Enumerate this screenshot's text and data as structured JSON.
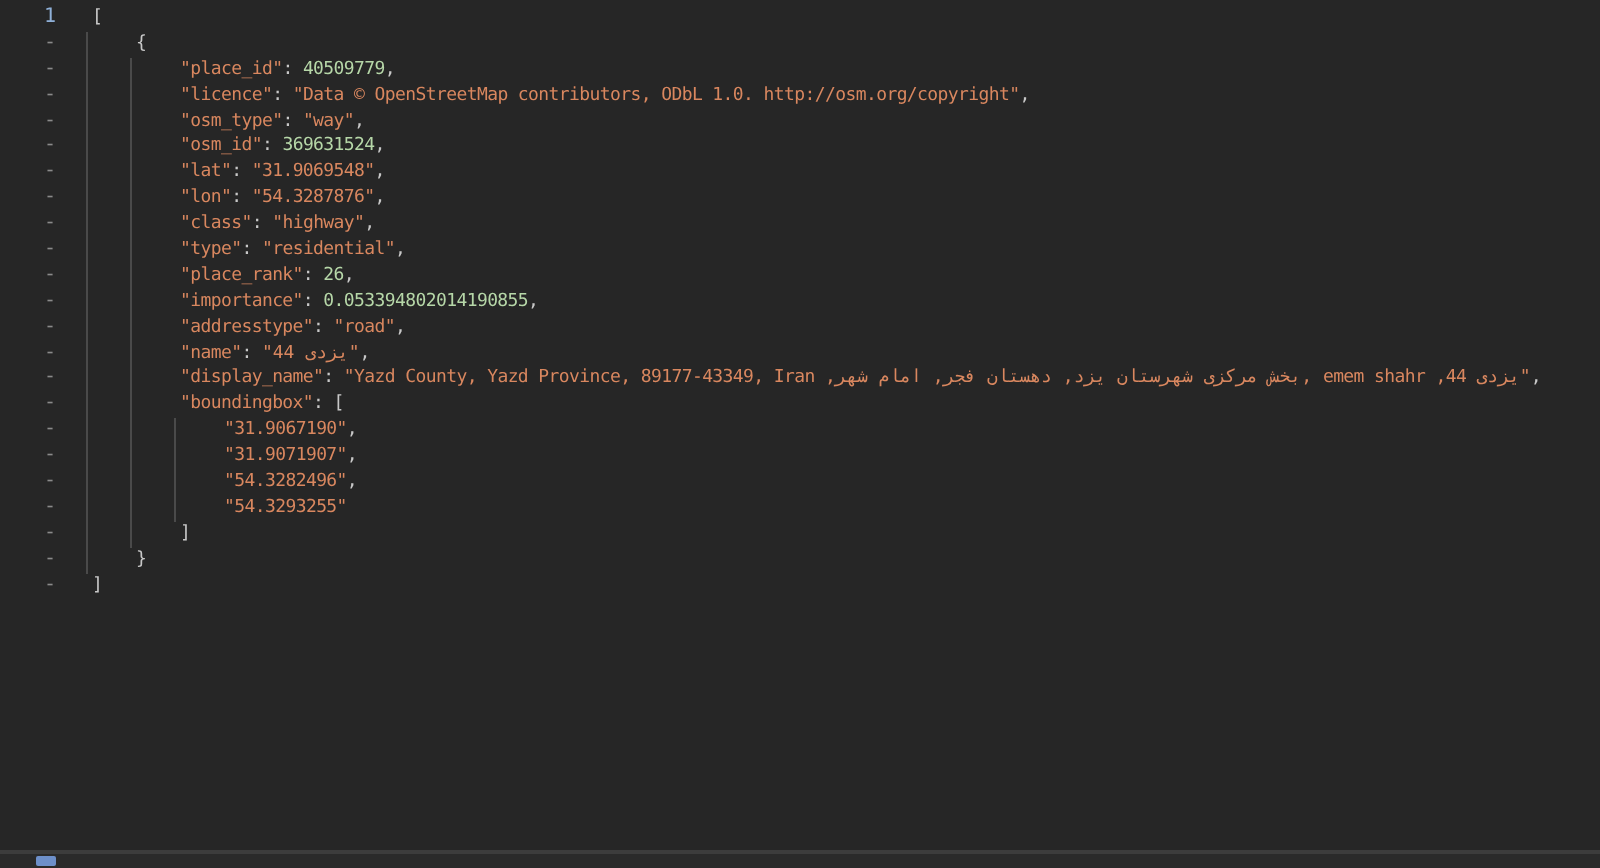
{
  "editor": {
    "lines": [
      {
        "gutter": "1",
        "tokens": [
          {
            "kind": "punct",
            "text": "["
          }
        ],
        "children": [
          {
            "gutter": "-",
            "tokens": [
              {
                "kind": "punct",
                "text": "{"
              }
            ],
            "children": [
              {
                "gutter": "-",
                "tokens": [
                  {
                    "kind": "key",
                    "text": "\"place_id\""
                  },
                  {
                    "kind": "punct",
                    "text": ": "
                  },
                  {
                    "kind": "number",
                    "text": "40509779"
                  },
                  {
                    "kind": "punct",
                    "text": ","
                  }
                ]
              },
              {
                "gutter": "-",
                "tokens": [
                  {
                    "kind": "key",
                    "text": "\"licence\""
                  },
                  {
                    "kind": "punct",
                    "text": ": "
                  },
                  {
                    "kind": "string",
                    "text": "\"Data © OpenStreetMap contributors, ODbL 1.0. http://osm.org/copyright\""
                  },
                  {
                    "kind": "punct",
                    "text": ","
                  }
                ]
              },
              {
                "gutter": "-",
                "tokens": [
                  {
                    "kind": "key",
                    "text": "\"osm_type\""
                  },
                  {
                    "kind": "punct",
                    "text": ": "
                  },
                  {
                    "kind": "string",
                    "text": "\"way\""
                  },
                  {
                    "kind": "punct",
                    "text": ","
                  }
                ]
              },
              {
                "gutter": "-",
                "tokens": [
                  {
                    "kind": "key",
                    "text": "\"osm_id\""
                  },
                  {
                    "kind": "punct",
                    "text": ": "
                  },
                  {
                    "kind": "number",
                    "text": "369631524"
                  },
                  {
                    "kind": "punct",
                    "text": ","
                  }
                ]
              },
              {
                "gutter": "-",
                "tokens": [
                  {
                    "kind": "key",
                    "text": "\"lat\""
                  },
                  {
                    "kind": "punct",
                    "text": ": "
                  },
                  {
                    "kind": "string",
                    "text": "\"31.9069548\""
                  },
                  {
                    "kind": "punct",
                    "text": ","
                  }
                ]
              },
              {
                "gutter": "-",
                "tokens": [
                  {
                    "kind": "key",
                    "text": "\"lon\""
                  },
                  {
                    "kind": "punct",
                    "text": ": "
                  },
                  {
                    "kind": "string",
                    "text": "\"54.3287876\""
                  },
                  {
                    "kind": "punct",
                    "text": ","
                  }
                ]
              },
              {
                "gutter": "-",
                "tokens": [
                  {
                    "kind": "key",
                    "text": "\"class\""
                  },
                  {
                    "kind": "punct",
                    "text": ": "
                  },
                  {
                    "kind": "string",
                    "text": "\"highway\""
                  },
                  {
                    "kind": "punct",
                    "text": ","
                  }
                ]
              },
              {
                "gutter": "-",
                "tokens": [
                  {
                    "kind": "key",
                    "text": "\"type\""
                  },
                  {
                    "kind": "punct",
                    "text": ": "
                  },
                  {
                    "kind": "string",
                    "text": "\"residential\""
                  },
                  {
                    "kind": "punct",
                    "text": ","
                  }
                ]
              },
              {
                "gutter": "-",
                "tokens": [
                  {
                    "kind": "key",
                    "text": "\"place_rank\""
                  },
                  {
                    "kind": "punct",
                    "text": ": "
                  },
                  {
                    "kind": "number",
                    "text": "26"
                  },
                  {
                    "kind": "punct",
                    "text": ","
                  }
                ]
              },
              {
                "gutter": "-",
                "tokens": [
                  {
                    "kind": "key",
                    "text": "\"importance\""
                  },
                  {
                    "kind": "punct",
                    "text": ": "
                  },
                  {
                    "kind": "number",
                    "text": "0.053394802014190855"
                  },
                  {
                    "kind": "punct",
                    "text": ","
                  }
                ]
              },
              {
                "gutter": "-",
                "tokens": [
                  {
                    "kind": "key",
                    "text": "\"addresstype\""
                  },
                  {
                    "kind": "punct",
                    "text": ": "
                  },
                  {
                    "kind": "string",
                    "text": "\"road\""
                  },
                  {
                    "kind": "punct",
                    "text": ","
                  }
                ]
              },
              {
                "gutter": "-",
                "tokens": [
                  {
                    "kind": "key",
                    "text": "\"name\""
                  },
                  {
                    "kind": "punct",
                    "text": ": "
                  },
                  {
                    "kind": "string",
                    "text": "\"یزدی 44\""
                  },
                  {
                    "kind": "punct",
                    "text": ","
                  }
                ]
              },
              {
                "gutter": "-",
                "tokens": [
                  {
                    "kind": "key",
                    "text": "\"display_name\""
                  },
                  {
                    "kind": "punct",
                    "text": ": "
                  },
                  {
                    "kind": "string",
                    "text": "\"Yazd County, Yazd Province, 89177-43349, Iran ,بخش مرکزی شهرستان یزد, دهستان فجر, امام شهر, emem shahr ,44 یزدی\""
                  },
                  {
                    "kind": "punct",
                    "text": ","
                  }
                ]
              },
              {
                "gutter": "-",
                "tokens": [
                  {
                    "kind": "key",
                    "text": "\"boundingbox\""
                  },
                  {
                    "kind": "punct",
                    "text": ": ["
                  }
                ],
                "children": [
                  {
                    "gutter": "-",
                    "tokens": [
                      {
                        "kind": "string",
                        "text": "\"31.9067190\""
                      },
                      {
                        "kind": "punct",
                        "text": ","
                      }
                    ]
                  },
                  {
                    "gutter": "-",
                    "tokens": [
                      {
                        "kind": "string",
                        "text": "\"31.9071907\""
                      },
                      {
                        "kind": "punct",
                        "text": ","
                      }
                    ]
                  },
                  {
                    "gutter": "-",
                    "tokens": [
                      {
                        "kind": "string",
                        "text": "\"54.3282496\""
                      },
                      {
                        "kind": "punct",
                        "text": ","
                      }
                    ]
                  },
                  {
                    "gutter": "-",
                    "tokens": [
                      {
                        "kind": "string",
                        "text": "\"54.3293255\""
                      }
                    ]
                  }
                ]
              },
              {
                "gutter": "-",
                "tokens": [
                  {
                    "kind": "punct",
                    "text": "]"
                  }
                ]
              }
            ]
          },
          {
            "gutter": "-",
            "tokens": [
              {
                "kind": "punct",
                "text": "}"
              }
            ]
          }
        ]
      },
      {
        "gutter": "-",
        "tokens": [
          {
            "kind": "punct",
            "text": "]"
          }
        ]
      }
    ]
  }
}
